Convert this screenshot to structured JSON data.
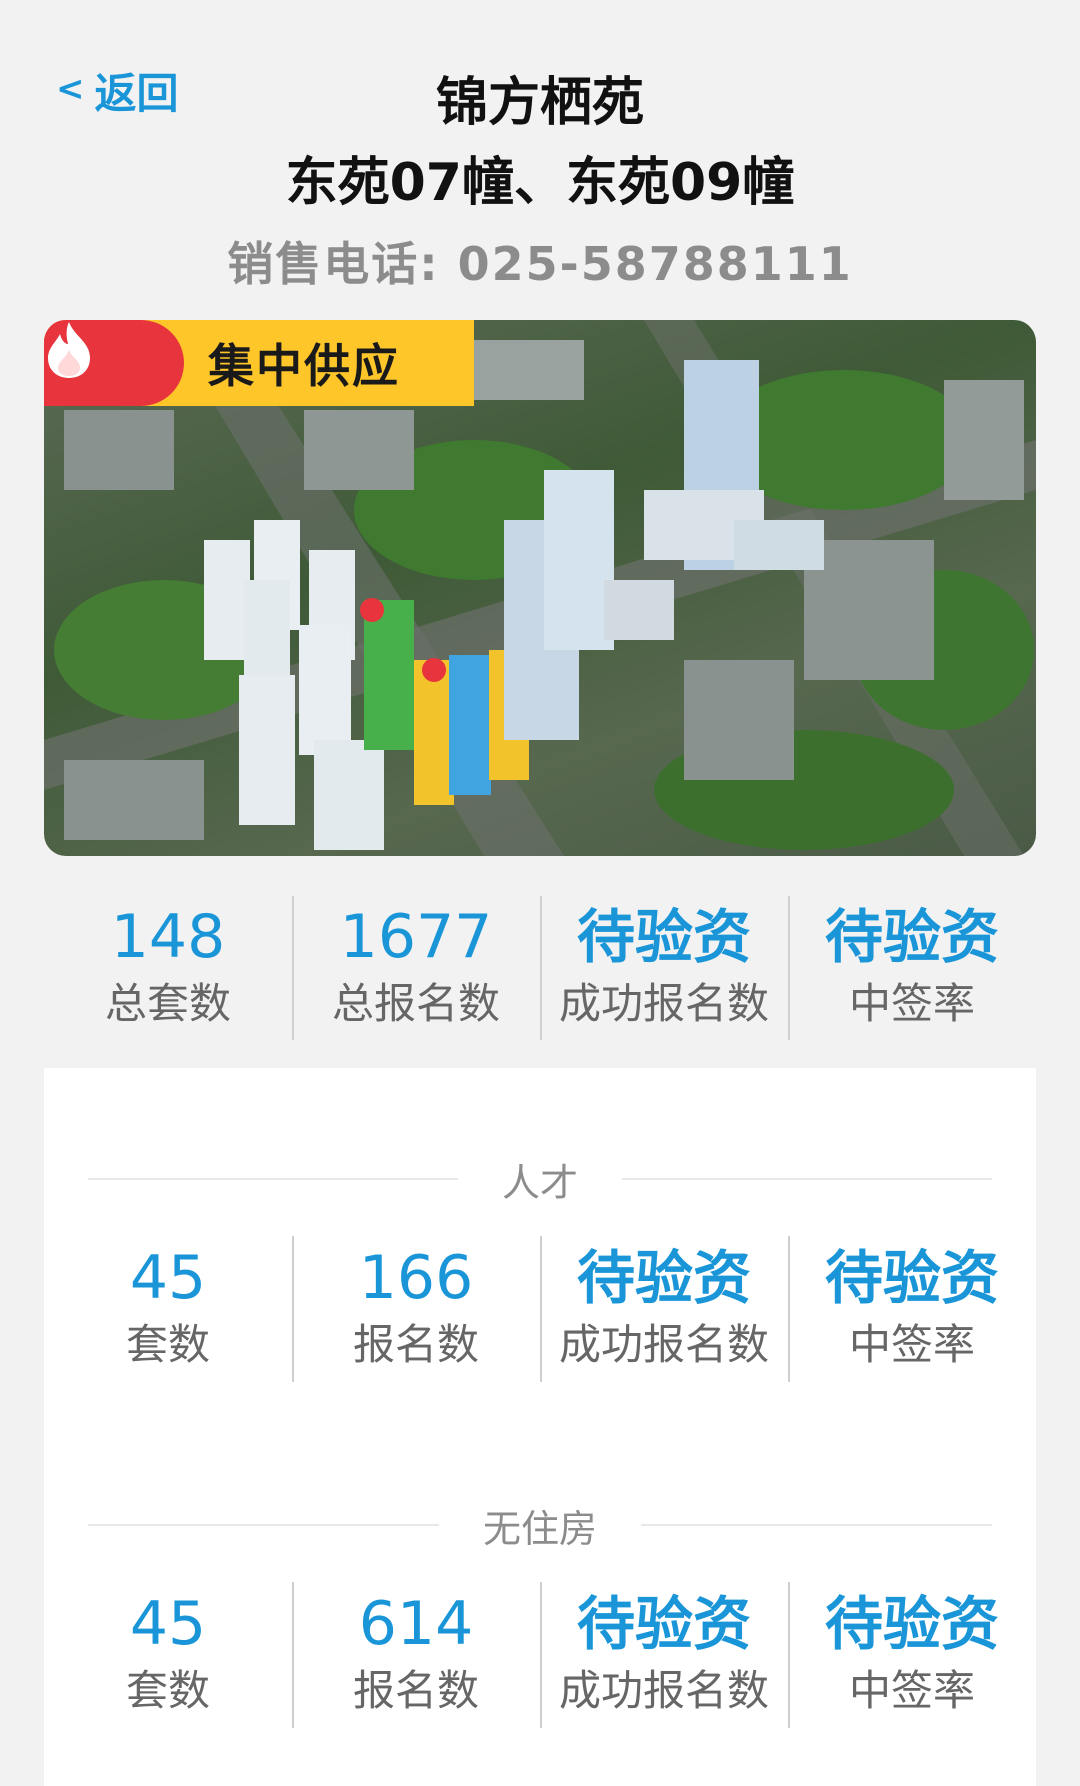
{
  "header": {
    "back_label": "返回",
    "title_line1": "锦方栖苑",
    "title_line2": "东苑07幢、东苑09幢",
    "phone": "销售电话: 025-58788111"
  },
  "hero": {
    "badge_label": "集中供应"
  },
  "summary": [
    {
      "value": "148",
      "label": "总套数"
    },
    {
      "value": "1677",
      "label": "总报名数"
    },
    {
      "value": "待验资",
      "label": "成功报名数"
    },
    {
      "value": "待验资",
      "label": "中签率"
    }
  ],
  "sections": [
    {
      "title": "人才",
      "stats": [
        {
          "value": "45",
          "label": "套数"
        },
        {
          "value": "166",
          "label": "报名数"
        },
        {
          "value": "待验资",
          "label": "成功报名数"
        },
        {
          "value": "待验资",
          "label": "中签率"
        }
      ]
    },
    {
      "title": "无住房",
      "stats": [
        {
          "value": "45",
          "label": "套数"
        },
        {
          "value": "614",
          "label": "报名数"
        },
        {
          "value": "待验资",
          "label": "成功报名数"
        },
        {
          "value": "待验资",
          "label": "中签率"
        }
      ]
    }
  ],
  "colors": {
    "accent": "#1a96d8",
    "badge_bg": "#ffc62a",
    "fire_bg": "#e8353d"
  }
}
